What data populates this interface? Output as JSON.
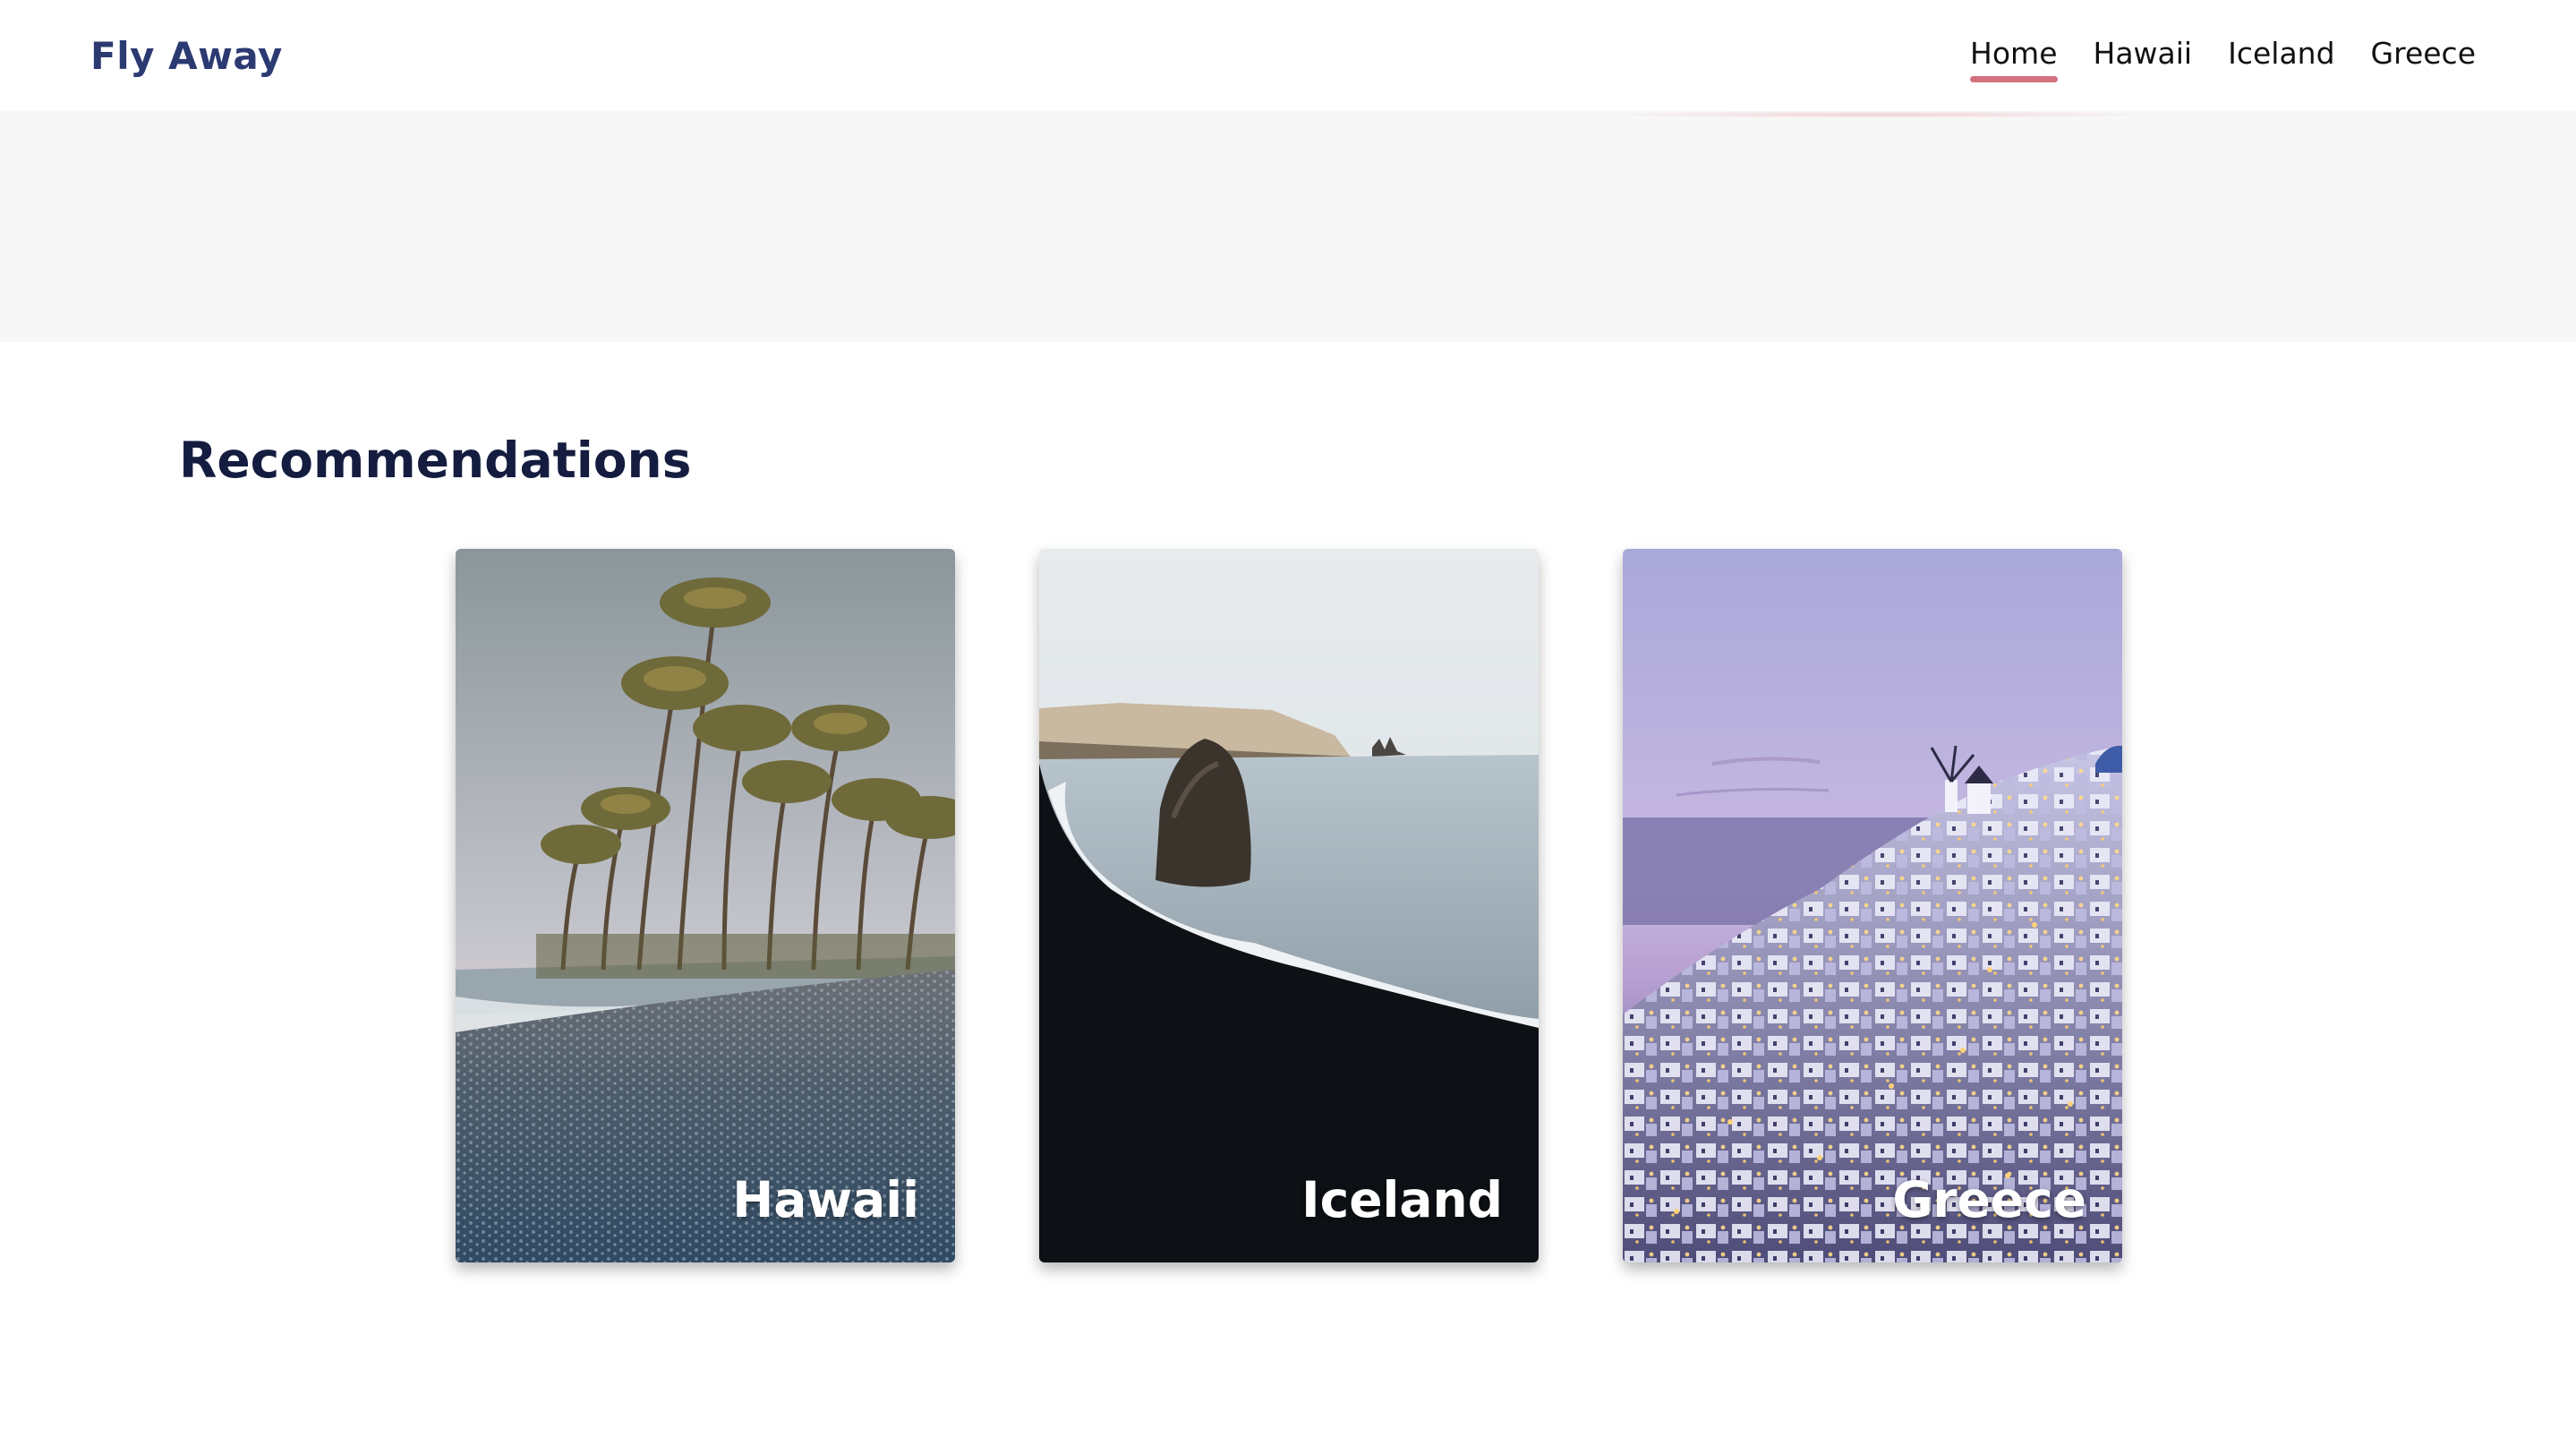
{
  "header": {
    "brand": "Fly Away",
    "nav": [
      {
        "label": "Home",
        "active": true
      },
      {
        "label": "Hawaii",
        "active": false
      },
      {
        "label": "Iceland",
        "active": false
      },
      {
        "label": "Greece",
        "active": false
      }
    ]
  },
  "recommendations": {
    "title": "Recommendations",
    "cards": [
      {
        "label": "Hawaii"
      },
      {
        "label": "Iceland"
      },
      {
        "label": "Greece"
      }
    ]
  },
  "colors": {
    "brand": "#2c3a72",
    "nav_active_underline": "#d4717e",
    "section_title": "#141d40",
    "hero_band": "#f7f7f7"
  }
}
